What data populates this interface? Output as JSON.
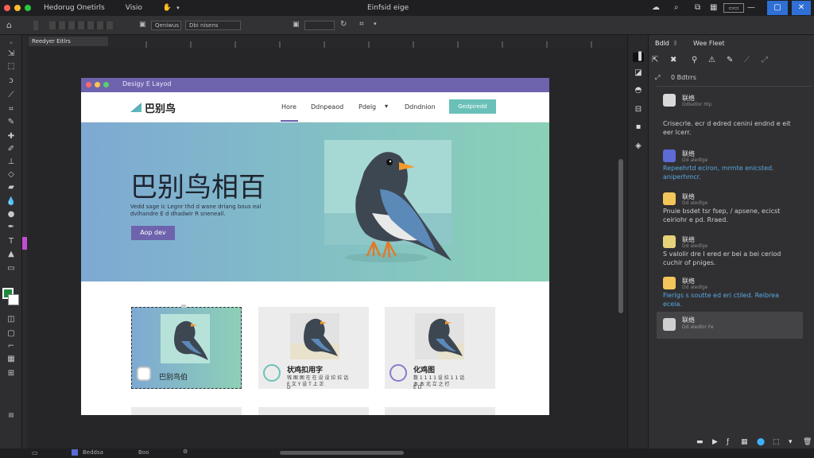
{
  "menubar": {
    "app_name": "Hedorug Onetirls",
    "view_menu": "Visio",
    "title": "Einfsid eige"
  },
  "options": {
    "field1": "Qeniwus",
    "field2": "Dbi nisens"
  },
  "tabs": {
    "active_tab": "Reedyer Eitlrs"
  },
  "document": {
    "window_title": "Desigy E Layod",
    "brand": "巴别鸟",
    "nav": {
      "home": "Hore",
      "item2": "Ddnpeaod",
      "item3": "Pdelg",
      "item4": "Ddndnion",
      "cta": "Gedpiredd"
    },
    "hero": {
      "heading": "巴别鸟相百",
      "subtext_line1": "Vedd sage ic Legnr thd d wane driang bous eal",
      "subtext_line2": "dvihandre E d dhadwir R sneneall.",
      "button": "Aop dev"
    },
    "cards": [
      {
        "title": "巴别鸟伯"
      },
      {
        "title": "状鸡扣用字",
        "desc_line1": "钱 图 图 在 在 设 设 拉 拉 话",
        "desc_line2": "E 文 Y 设 T 上 正",
        "desc_line3": "D"
      },
      {
        "title": "化鸡图",
        "desc_line1": "数 1 1 1 1 设 拉 1 1 话",
        "desc_line2": "本 本 北 立 之 打",
        "desc_line3": "E D"
      }
    ]
  },
  "panel": {
    "tab_active": "Bdld",
    "tab_2": "Wee Fleet",
    "filter_label": "0 Bdtrrs",
    "comments": [
      {
        "name": "联络",
        "time": "Ddledlor Hlp",
        "body": "Crisecrle. ecr d edred cenini endnd e eit eer lcerr.",
        "avatar_color": "#d9d9d9"
      },
      {
        "name": "联络",
        "time": "Dd aledlge",
        "body": "Repeehrtd eciron, mrmte enicsted. aniperhmcr.",
        "avatar_color": "#5c6bd6"
      },
      {
        "name": "联络",
        "time": "Dd aledlge",
        "body": "Pnuie bsdet tsr fsep, / apsene, ecicst ceiriohr e pd. Rraed.",
        "avatar_color": "#f2c65b"
      },
      {
        "name": "联络",
        "time": "Dd aledlge",
        "body": "S valolir dre I ered er bei a bei ceriod cuchir of pniges.",
        "avatar_color": "#e6d27a"
      },
      {
        "name": "联络",
        "time": "Dd aledlge",
        "body": "Fierlgs s soutte ed eri ctiled. Reibrea eceia.",
        "avatar_color": "#f2c65b"
      },
      {
        "name": "联络",
        "time": "Dd aledlor Fe",
        "body": "",
        "avatar_color": "#cfcfcf"
      }
    ]
  },
  "statusbar": {
    "layer": "Beddsa",
    "zoom": "Boo"
  },
  "colors": {
    "accent": "#6e63ad",
    "hero_start": "#7ea9d3",
    "hero_end": "#8bd1b7",
    "cta": "#69c0b8"
  }
}
